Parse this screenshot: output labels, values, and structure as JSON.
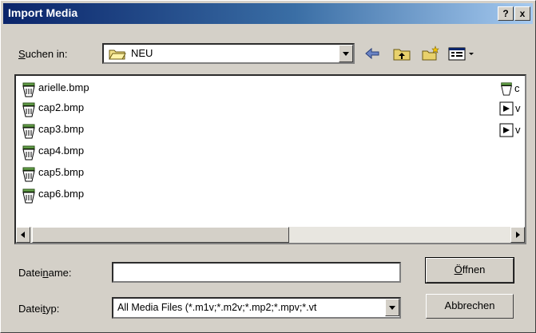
{
  "window": {
    "title": "Import Media",
    "help_label": "?",
    "close_label": "x"
  },
  "lookin": {
    "label_u": "S",
    "label_rest": "uchen in:",
    "value": "NEU"
  },
  "files": [
    {
      "name": "arielle.bmp"
    },
    {
      "name": "cap2.bmp"
    },
    {
      "name": "cap3.bmp"
    },
    {
      "name": "cap4.bmp"
    },
    {
      "name": "cap5.bmp"
    },
    {
      "name": "cap6.bmp"
    }
  ],
  "side_files": [
    {
      "name": "c"
    },
    {
      "name": "v"
    },
    {
      "name": "v"
    }
  ],
  "filename": {
    "label_pre": "Datei",
    "label_u": "n",
    "label_post": "ame:",
    "value": ""
  },
  "filetype": {
    "label_pre": "Datei",
    "label_u": "t",
    "label_post": "yp:",
    "value": "All Media Files (*.m1v;*.m2v;*.mp2;*.mpv;*.vt"
  },
  "buttons": {
    "open_u": "Ö",
    "open_rest": "ffnen",
    "cancel": "Abbrechen"
  },
  "colors": {
    "title_start": "#0a246a",
    "title_end": "#a6caf0",
    "face": "#d4d0c8"
  }
}
